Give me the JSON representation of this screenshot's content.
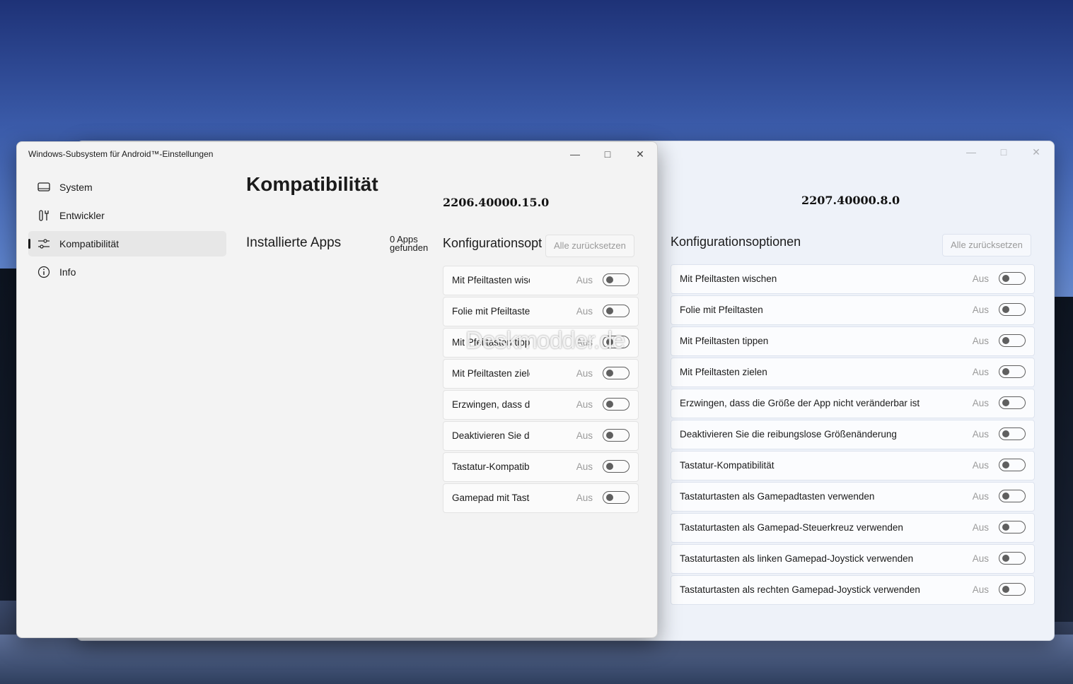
{
  "front": {
    "window_title": "Windows-Subsystem für Android™-Einstellungen",
    "nav": [
      {
        "label": "System"
      },
      {
        "label": "Entwickler"
      },
      {
        "label": "Kompatibilität"
      },
      {
        "label": "Info"
      }
    ],
    "page_title": "Kompatibilität",
    "version": "2206.40000.15.0",
    "installed_apps_label": "Installierte Apps",
    "apps_found": "0 Apps gefunden",
    "config_heading": "Konfigurationsoptionen",
    "reset_label": "Alle zurücksetzen",
    "options": [
      {
        "label": "Mit Pfeiltasten wischen",
        "state": "Aus"
      },
      {
        "label": "Folie mit Pfeiltasten",
        "state": "Aus"
      },
      {
        "label": "Mit Pfeiltasten tippen",
        "state": "Aus"
      },
      {
        "label": "Mit Pfeiltasten zielen",
        "state": "Aus"
      },
      {
        "label": "Erzwingen, dass die Größe der App nicht veränderbar ist",
        "state": "Aus"
      },
      {
        "label": "Deaktivieren Sie die reibungslose Größenänderung",
        "state": "Aus"
      },
      {
        "label": "Tastatur-Kompatibilität",
        "state": "Aus"
      },
      {
        "label": "Gamepad mit Tastatur",
        "state": "Aus"
      }
    ]
  },
  "back": {
    "version": "2207.40000.8.0",
    "config_heading": "Konfigurationsoptionen",
    "reset_label": "Alle zurücksetzen",
    "options": [
      {
        "label": "Mit Pfeiltasten wischen",
        "state": "Aus"
      },
      {
        "label": "Folie mit Pfeiltasten",
        "state": "Aus"
      },
      {
        "label": "Mit Pfeiltasten tippen",
        "state": "Aus"
      },
      {
        "label": "Mit Pfeiltasten zielen",
        "state": "Aus"
      },
      {
        "label": "Erzwingen, dass die Größe der App nicht veränderbar ist",
        "state": "Aus"
      },
      {
        "label": "Deaktivieren Sie die reibungslose Größenänderung",
        "state": "Aus"
      },
      {
        "label": "Tastatur-Kompatibilität",
        "state": "Aus"
      },
      {
        "label": "Tastaturtasten als Gamepadtasten verwenden",
        "state": "Aus"
      },
      {
        "label": "Tastaturtasten als Gamepad-Steuerkreuz verwenden",
        "state": "Aus"
      },
      {
        "label": "Tastaturtasten als linken Gamepad-Joystick verwenden",
        "state": "Aus"
      },
      {
        "label": "Tastaturtasten als rechten Gamepad-Joystick verwenden",
        "state": "Aus"
      }
    ]
  },
  "watermark": "Deskmodder.de"
}
